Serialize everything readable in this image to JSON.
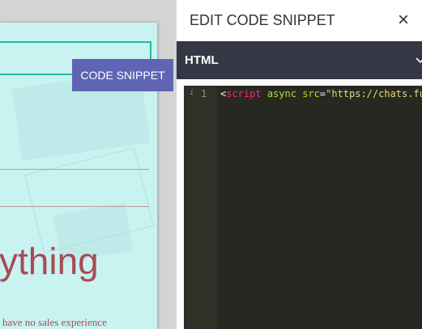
{
  "preview": {
    "big_text": "ything",
    "small_text": "have no sales experience",
    "snippet_tag": "CODE SNIPPET"
  },
  "panel": {
    "title": "EDIT CODE SNIPPET",
    "close_icon": "×",
    "language": "HTML"
  },
  "editor": {
    "gutter_info": "i",
    "line_number": "1",
    "code": {
      "open": "<",
      "tag": "script",
      "sp1": " ",
      "attr_async": "async",
      "sp2": " ",
      "attr_src": "src",
      "eq": "=",
      "str": "\"https://chats.fu"
    }
  },
  "colors": {
    "snippet_tag_bg": "#5f64b5",
    "lang_bar_bg": "#343845",
    "editor_bg": "#272822",
    "accent_teal": "#23b9a0",
    "text_red": "#a84b55"
  }
}
